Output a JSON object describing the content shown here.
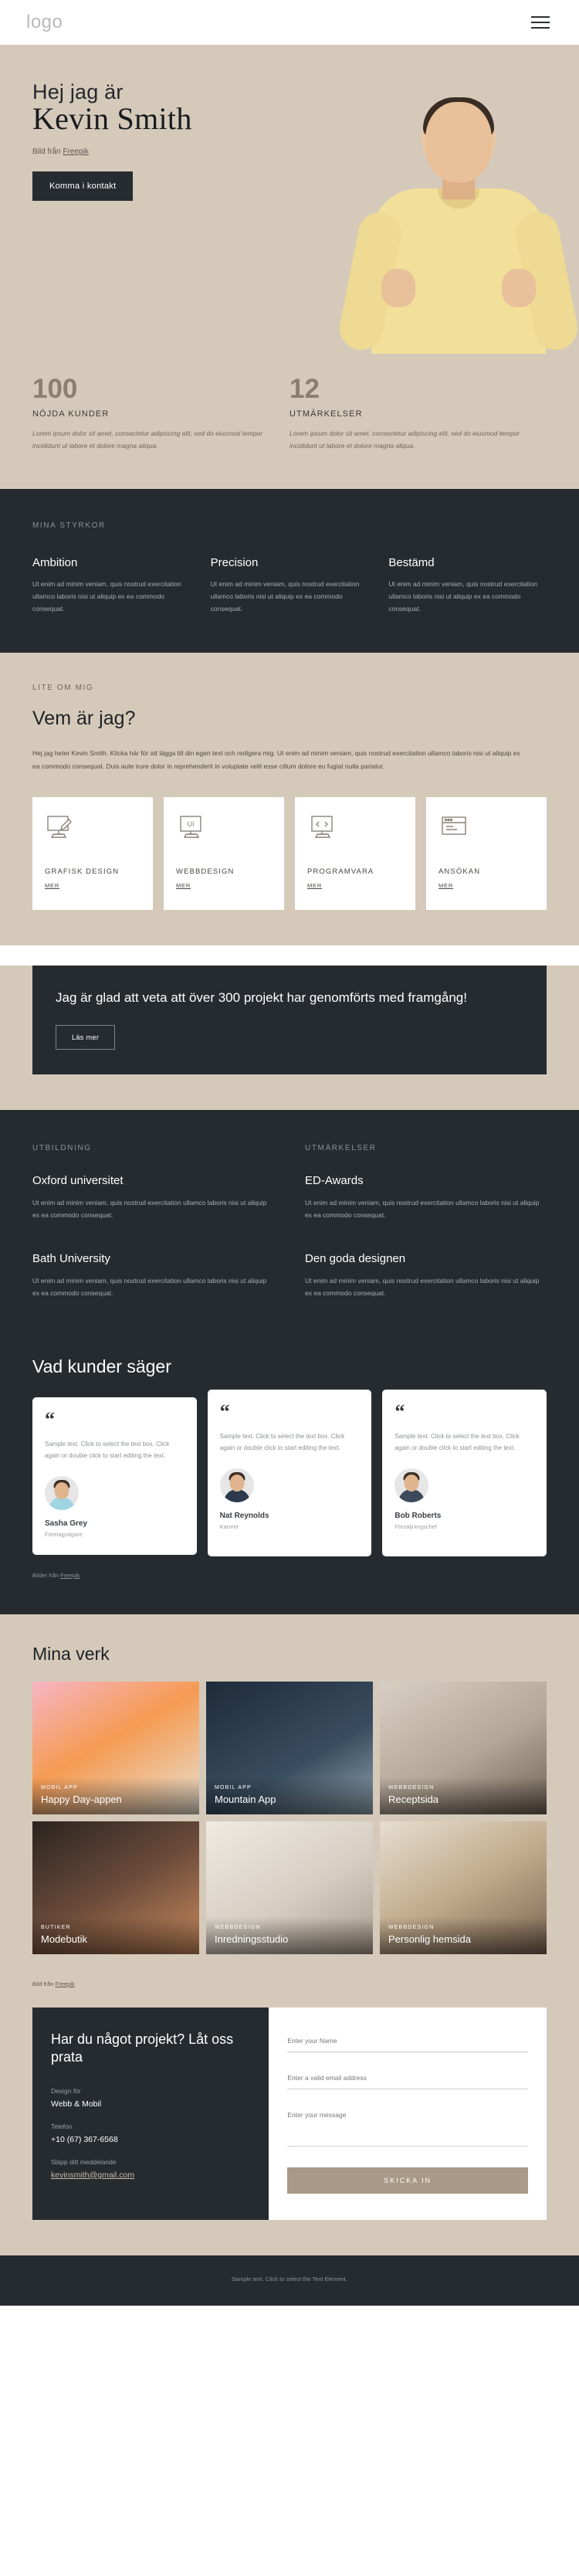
{
  "nav": {
    "logo": "logo",
    "menu_icon": "hamburger-menu-icon"
  },
  "hero": {
    "greeting": "Hej jag är",
    "name": "Kevin Smith",
    "credit_prefix": "Bild från ",
    "credit_link": "Freepik",
    "cta": "Komma i kontakt"
  },
  "stats": [
    {
      "number": "100",
      "label": "NÖJDA KUNDER",
      "text": "Lorem ipsum dolor sit amet, consectetur adipiscing elit, sed do eiusmod tempor incididunt ut labore et dolore magna aliqua."
    },
    {
      "number": "12",
      "label": "UTMÄRKELSER",
      "text": "Lorem ipsum dolor sit amet, consectetur adipiscing elit, sed do eiusmod tempor incididunt ut labore et dolore magna aliqua."
    }
  ],
  "strengths": {
    "eyebrow": "MINA STYRKOR",
    "items": [
      {
        "title": "Ambition",
        "text": "Ut enim ad minim veniam, quis nostrud exercitation ullamco laboris nisi ut aliquip ex ea commodo consequat."
      },
      {
        "title": "Precision",
        "text": "Ut enim ad minim veniam, quis nostrud exercitation ullamco laboris nisi ut aliquip ex ea commodo consequat."
      },
      {
        "title": "Bestämd",
        "text": "Ut enim ad minim veniam, quis nostrud exercitation ullamco laboris nisi ut aliquip ex ea commodo consequat."
      }
    ]
  },
  "about": {
    "eyebrow": "LITE OM MIG",
    "heading": "Vem är jag?",
    "lead": "Hej jag heter Kevin Smith. Klicka här för att lägga till din egen text och redigera mig. Ut enim ad minim veniam, quis nostrud exercitation ullamco laboris nisi ut aliquip ex ea commodo consequat. Duis aute irure dolor in reprehenderit in voluptate velit esse cillum dolore eu fugiat nulla pariatur.",
    "cards": [
      {
        "title": "GRAFISK DESIGN",
        "link": "MER",
        "icon": "design-tablet-brush-icon"
      },
      {
        "title": "WEBBDESIGN",
        "link": "MER",
        "icon": "ui-monitor-icon"
      },
      {
        "title": "PROGRAMVARA",
        "link": "MER",
        "icon": "code-monitor-icon"
      },
      {
        "title": "ANSÖKAN",
        "link": "MER",
        "icon": "browser-window-icon"
      }
    ]
  },
  "banner": {
    "heading": "Jag är glad att veta att över 300 projekt har genomförts med framgång!",
    "button": "Läs mer"
  },
  "education": {
    "left_eyebrow": "UTBILDNING",
    "right_eyebrow": "UTMÄRKELSER",
    "left_items": [
      {
        "title": "Oxford universitet",
        "text": "Ut enim ad minim veniam, quis nostrud exercitation ullamco laboris nisi ut aliquip ex ea commodo consequat."
      },
      {
        "title": "Bath University",
        "text": "Ut enim ad minim veniam, quis nostrud exercitation ullamco laboris nisi ut aliquip ex ea commodo consequat."
      }
    ],
    "right_items": [
      {
        "title": "ED-Awards",
        "text": "Ut enim ad minim veniam, quis nostrud exercitation ullamco laboris nisi ut aliquip ex ea commodo consequat."
      },
      {
        "title": "Den goda designen",
        "text": "Ut enim ad minim veniam, quis nostrud exercitation ullamco laboris nisi ut aliquip ex ea commodo consequat."
      }
    ]
  },
  "testimonials": {
    "heading": "Vad kunder säger",
    "credit_prefix": "Bilder från ",
    "credit_link": "Freepik",
    "items": [
      {
        "quote_mark": "“",
        "text": "Sample text. Click to select the text box. Click again or double click to start editing the text.",
        "name": "Sasha Grey",
        "role": "Företagsägare",
        "avatar": "avatar-sasha-grey",
        "shirt": "#9fd4e3"
      },
      {
        "quote_mark": "“",
        "text": "Sample text. Click to select the text box. Click again or double click to start editing the text.",
        "name": "Nat Reynolds",
        "role": "Kamrer",
        "avatar": "avatar-nat-reynolds",
        "shirt": "#2d3a4e"
      },
      {
        "quote_mark": "“",
        "text": "Sample text. Click to select the text box. Click again or double click to start editing the text.",
        "name": "Bob Roberts",
        "role": "Försäljningschef",
        "avatar": "avatar-bob-roberts",
        "shirt": "#3c4a5c"
      }
    ]
  },
  "works": {
    "heading": "Mina verk",
    "credit_prefix": "Bild från ",
    "credit_link": "Freepik",
    "items": [
      {
        "tag": "MOBIL APP",
        "title": "Happy Day-appen",
        "bg": "linear-gradient(150deg,#f7b5c4 0%,#f59b53 45%,#e8e0d0 100%)"
      },
      {
        "tag": "MOBIL APP",
        "title": "Mountain App",
        "bg": "linear-gradient(150deg,#1e2b3a 0%,#3a4d60 60%,#8fa3ae 100%)"
      },
      {
        "tag": "WEBBDESIGN",
        "title": "Receptsida",
        "bg": "linear-gradient(150deg,#d8cfc4 0%,#b5a796 55%,#6f6257 100%)"
      },
      {
        "tag": "BUTIKER",
        "title": "Modebutik",
        "bg": "linear-gradient(150deg,#2b2420 0%,#6b4b3a 50%,#c98a5e 100%)"
      },
      {
        "tag": "WEBBDESIGN",
        "title": "Inredningsstudio",
        "bg": "linear-gradient(150deg,#efeae2 0%,#d6cec3 55%,#a99d8d 100%)"
      },
      {
        "tag": "WEBBDESIGN",
        "title": "Personlig hemsida",
        "bg": "linear-gradient(150deg,#e6decf 0%,#c2ab8d 50%,#7a6450 100%)"
      }
    ]
  },
  "contact": {
    "heading": "Har du något projekt? Låt oss prata",
    "design_label": "Design för",
    "design_value": "Webb & Mobil",
    "phone_label": "Telefon",
    "phone_value": "+10 (67) 367-6568",
    "message_label": "Släpp ditt meddelande",
    "email_value": "kevinsmith@gmail.com",
    "name_placeholder": "Enter your Name",
    "email_placeholder": "Enter a valid email address",
    "message_placeholder": "Enter your message",
    "submit": "SKICKA IN"
  },
  "footer": {
    "text": "Sample text. Click to select the Text Element."
  }
}
